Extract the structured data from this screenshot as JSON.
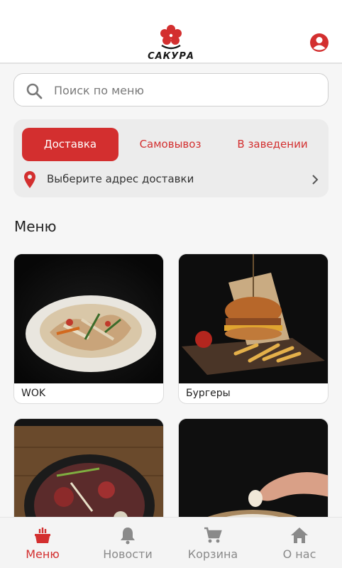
{
  "app": {
    "logo_text": "САКУРА",
    "brand_color": "#d32f2f"
  },
  "search": {
    "placeholder": "Поиск по меню",
    "value": ""
  },
  "order_mode": {
    "tabs": [
      {
        "label": "Доставка",
        "active": true
      },
      {
        "label": "Самовывоз",
        "active": false
      },
      {
        "label": "В заведении",
        "active": false
      }
    ],
    "address_prompt": "Выберите адрес доставки"
  },
  "menu": {
    "title": "Меню",
    "categories": [
      {
        "label": "WOK"
      },
      {
        "label": "Бургеры"
      },
      {
        "label": ""
      },
      {
        "label": ""
      }
    ]
  },
  "bottom_nav": {
    "items": [
      {
        "label": "Меню",
        "icon": "menu-food-icon",
        "active": true
      },
      {
        "label": "Новости",
        "icon": "bell-icon",
        "active": false
      },
      {
        "label": "Корзина",
        "icon": "cart-icon",
        "active": false
      },
      {
        "label": "О нас",
        "icon": "home-icon",
        "active": false
      }
    ]
  }
}
